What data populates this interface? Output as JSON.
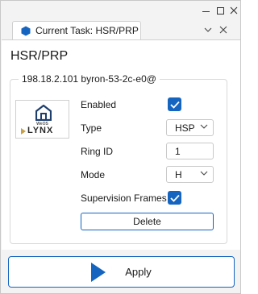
{
  "window": {
    "controls": [
      "minimize",
      "maximize",
      "close"
    ]
  },
  "tab": {
    "label": "Current Task: HSR/PRP",
    "icon": "hexagon-icon"
  },
  "pane": {
    "title": "HSR/PRP",
    "group_title": "198.18.2.101 byron-53-2c-e0@",
    "logo": {
      "brand_small": "WeOS",
      "brand": "LYNX"
    },
    "fields": {
      "enabled_label": "Enabled",
      "enabled_checked": true,
      "type_label": "Type",
      "type_value": "HSP",
      "ring_id_label": "Ring ID",
      "ring_id_value": "1",
      "mode_label": "Mode",
      "mode_value": "H",
      "supervision_label": "Supervision Frames",
      "supervision_checked": true
    },
    "delete_label": "Delete"
  },
  "footer": {
    "apply_label": "Apply"
  },
  "colors": {
    "accent": "#1565c0",
    "logo_arrow": "#c8a048"
  }
}
